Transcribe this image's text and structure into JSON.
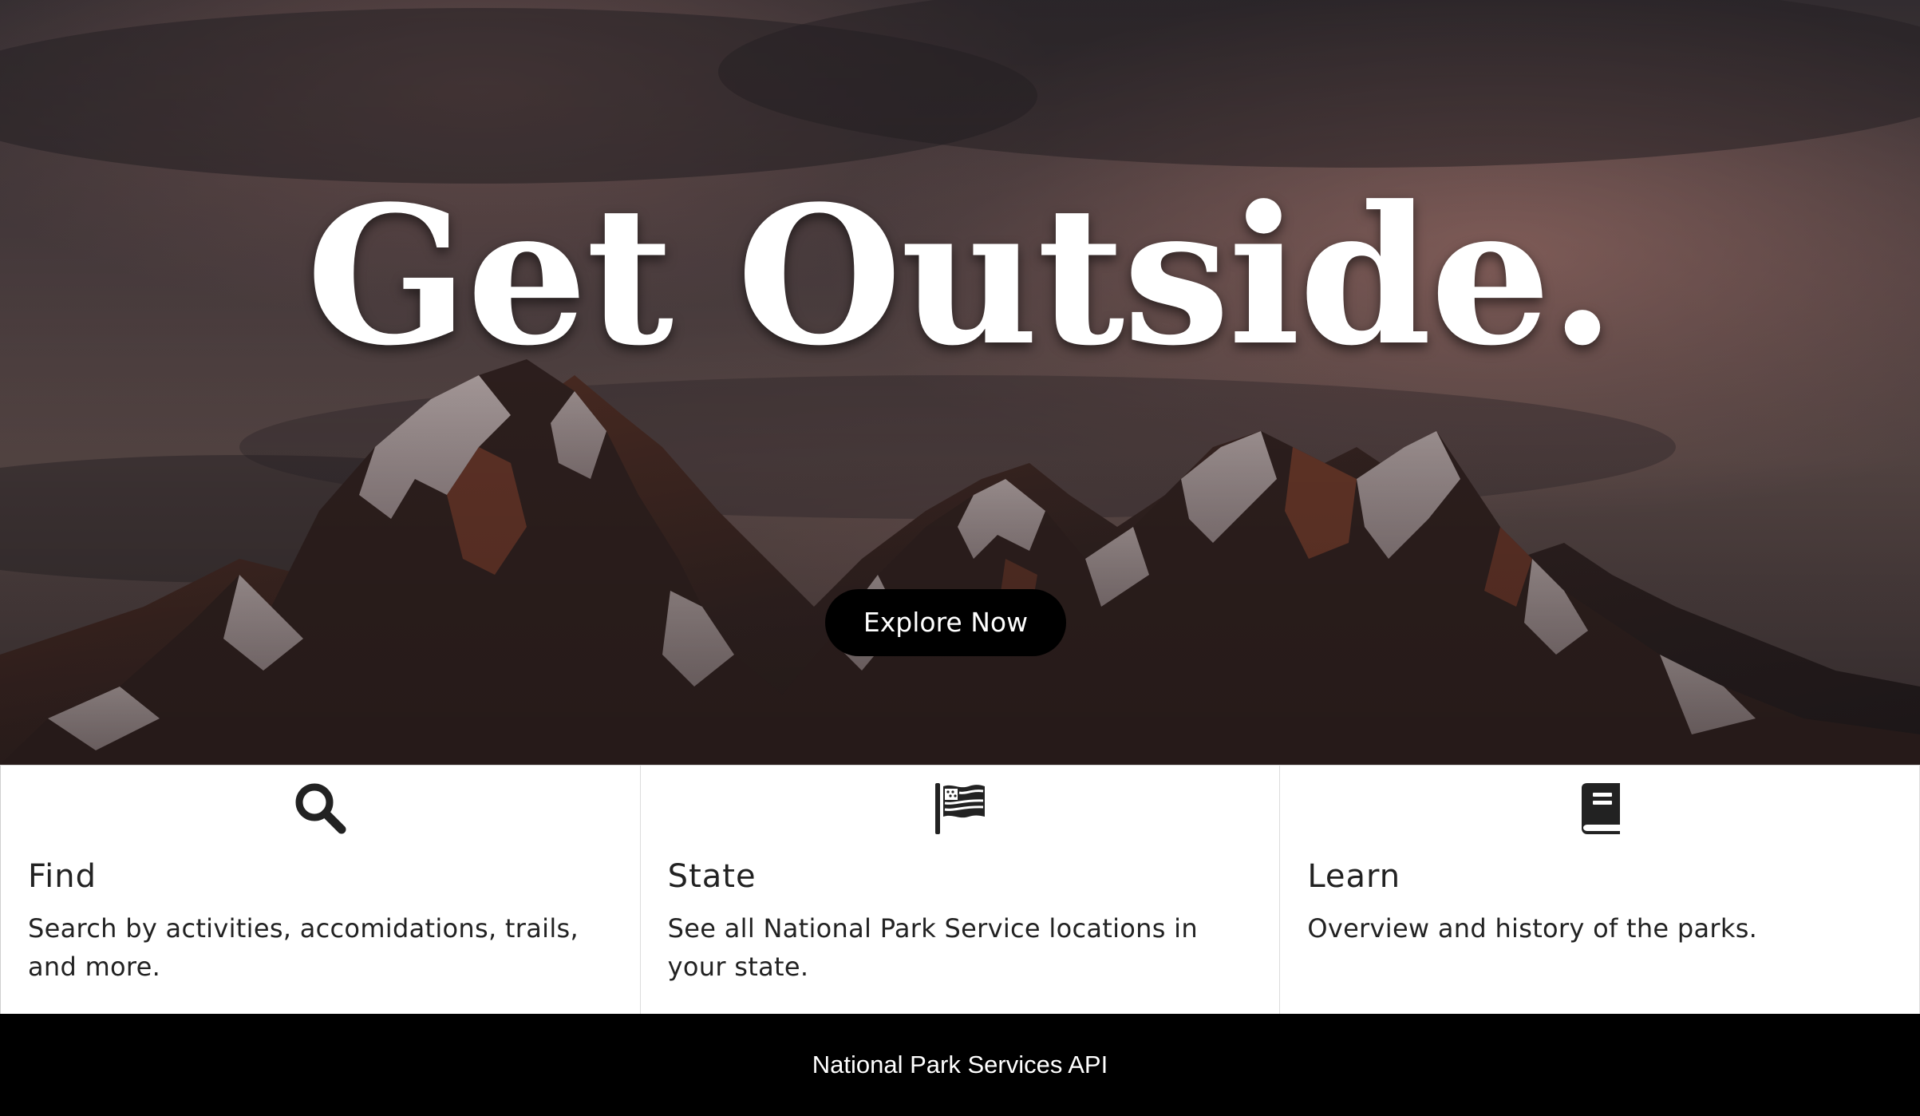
{
  "hero": {
    "title": "Get Outside.",
    "cta_label": "Explore Now"
  },
  "cards": [
    {
      "icon": "search-icon",
      "title": "Find",
      "description": "Search by activities, accomidations, trails, and more."
    },
    {
      "icon": "flag-icon",
      "title": "State",
      "description": "See all National Park Service locations in your state."
    },
    {
      "icon": "book-icon",
      "title": "Learn",
      "description": "Overview and history of the parks."
    }
  ],
  "footer": {
    "text": "National Park Services API"
  },
  "colors": {
    "footer_bg": "#000000",
    "button_bg": "#000000",
    "card_bg": "#ffffff",
    "text": "#222222"
  }
}
